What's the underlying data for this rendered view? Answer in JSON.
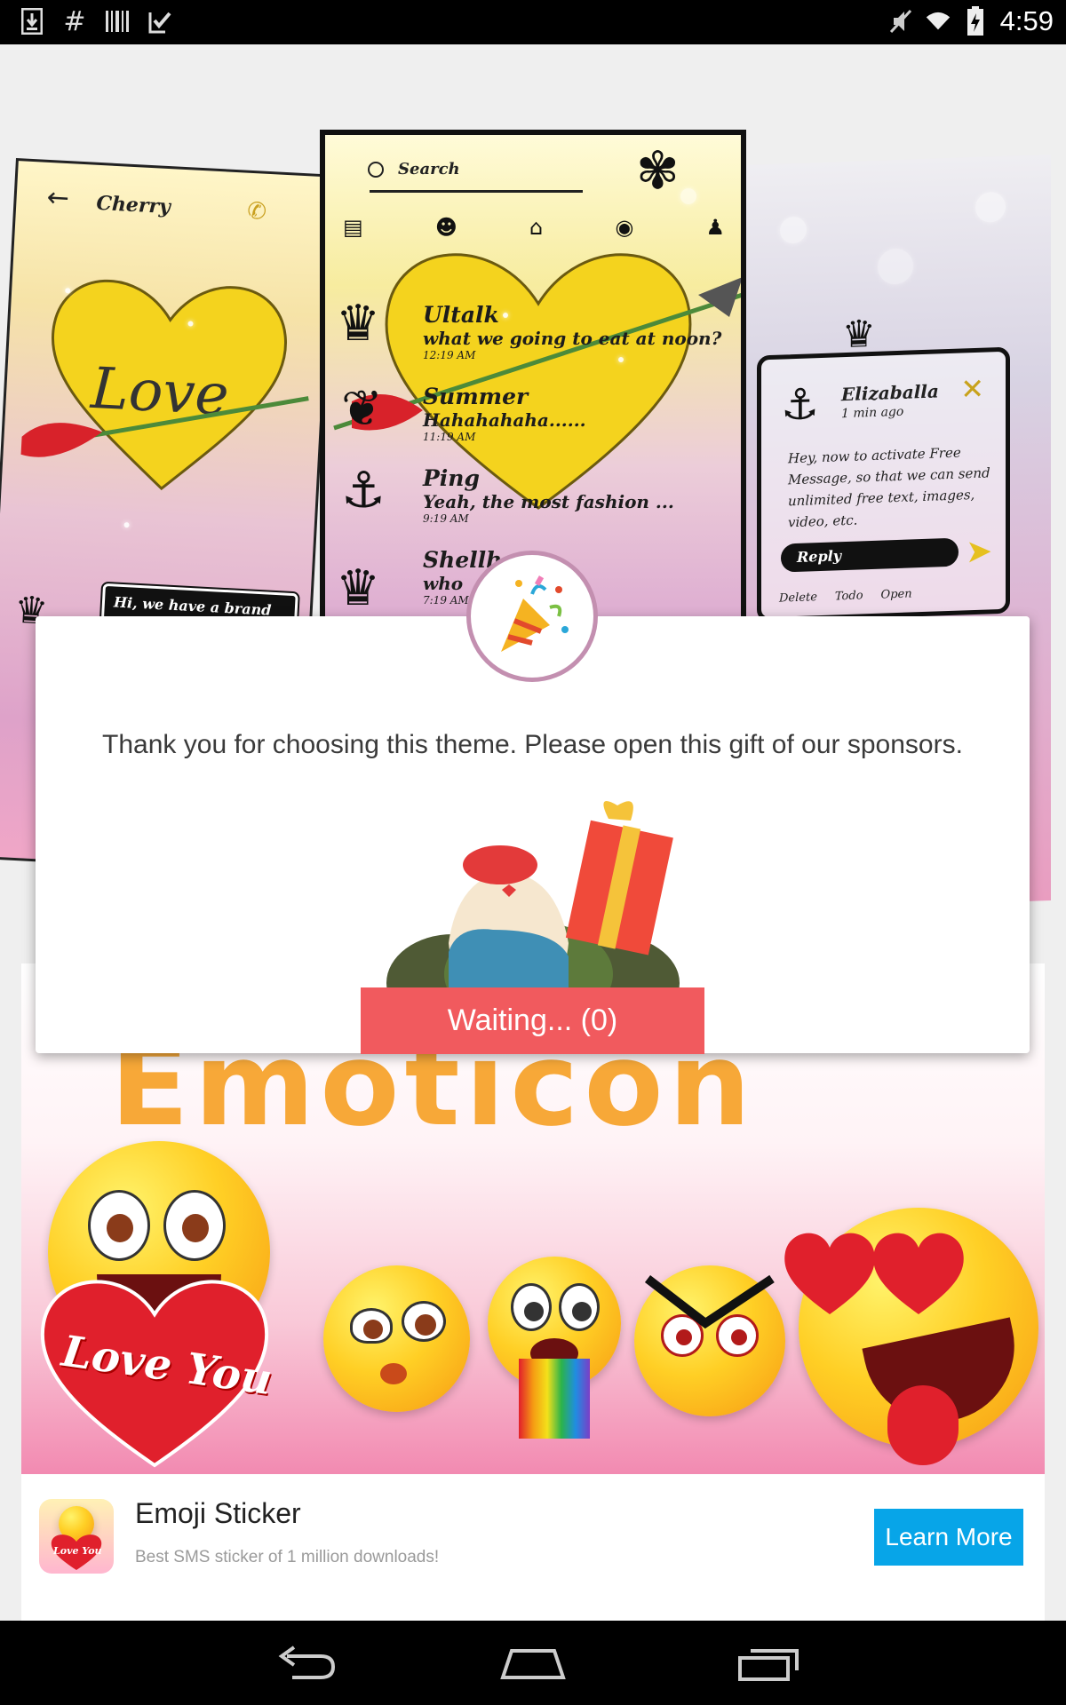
{
  "status_bar": {
    "time": "4:59",
    "left_icons": [
      "download-icon",
      "hash-icon",
      "barcode-icon",
      "checkbox-icon"
    ],
    "right_icons": [
      "mute-icon",
      "wifi-icon",
      "battery-icon"
    ]
  },
  "previews": {
    "left": {
      "contact_name": "Cherry",
      "heart_text": "Love",
      "bubble_text": "Hi, we have a brand new SMS theme .set."
    },
    "center": {
      "search_label": "Search",
      "messages": [
        {
          "name": "Ultalk",
          "text": "what we going to eat at noon?",
          "time": "12:19 AM"
        },
        {
          "name": "Summer",
          "text": "Hahahahaha......",
          "time": "11:19 AM"
        },
        {
          "name": "Ping",
          "text": "Yeah, the most fashion ...",
          "time": "9:19 AM"
        },
        {
          "name": "Shellh",
          "text": "who",
          "time": "7:19 AM"
        }
      ]
    },
    "right": {
      "sender": "Elizaballa",
      "ago": "1 min ago",
      "body": "Hey, now to activate Free Message, so that we can send unlimited free text, images, video, etc.",
      "reply_label": "Reply",
      "actions": [
        "Delete",
        "Todo",
        "Open"
      ]
    }
  },
  "dialog": {
    "message": "Thank you for choosing this theme. Please open this gift of our sponsors.",
    "button_label": "Waiting... (0)"
  },
  "ad": {
    "banner_title": "Emoticon",
    "love_text": "Love You",
    "app_name": "Emoji Sticker",
    "app_description": "Best SMS sticker of 1 million downloads!",
    "cta_label": "Learn More",
    "app_icon_text": "Love You"
  },
  "colors": {
    "wait_button": "#f15a5e",
    "cta_button": "#07a5e8",
    "status_bar": "#000000"
  }
}
